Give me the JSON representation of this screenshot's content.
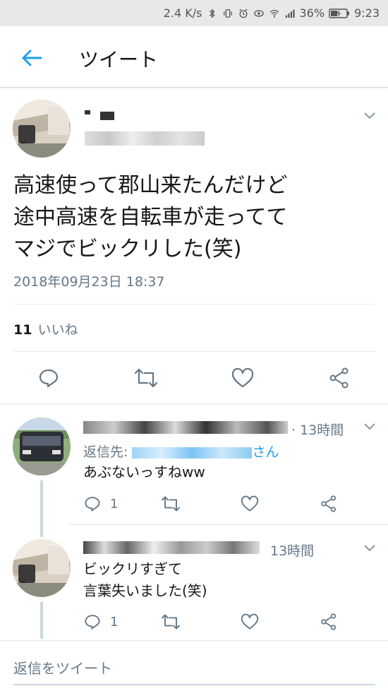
{
  "status_bar": {
    "network_speed": "2.4 K/s",
    "battery_percent": "36%",
    "time": "9:23"
  },
  "header": {
    "title": "ツイート"
  },
  "tweet": {
    "text": "高速使って郡山来たんだけど\n途中高速を自転車が走ってて\nマジでビックリした(笑)",
    "timestamp": "2018年09月23日 18:37",
    "like_count": "11",
    "like_label": "いいね"
  },
  "replies": [
    {
      "time": "· 13時間",
      "reply_to_prefix": "返信先:",
      "reply_to_suffix": "さん",
      "text": "あぶないっすねww",
      "reply_count": "1"
    },
    {
      "time": "13時間",
      "text": "ビックリすぎて\n言葉失いました(笑)",
      "reply_count": "1"
    }
  ],
  "footer": {
    "reply_placeholder": "返信をツイート"
  },
  "colors": {
    "accent": "#1da1f2",
    "secondary_text": "#657786",
    "divider": "#e6ecf0"
  }
}
